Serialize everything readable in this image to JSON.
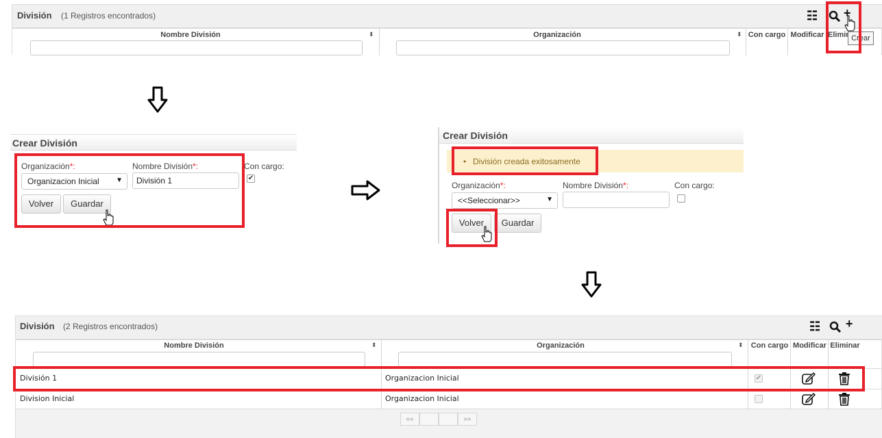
{
  "top_grid": {
    "title": "División",
    "count": "(1 Registros encontrados)",
    "headers": [
      "Nombre División",
      "Organización",
      "Con cargo",
      "Modificar",
      "Elimin"
    ],
    "tooltip": "Crear"
  },
  "form1": {
    "title": "Crear División",
    "org_label": "Organización",
    "name_label": "Nombre División",
    "charge_label": "Con cargo:",
    "required_mark": "*:",
    "org_value": "Organizacion Inicial",
    "name_value": "División 1",
    "charge_checked": true,
    "back_label": "Volver",
    "save_label": "Guardar"
  },
  "form2": {
    "title": "Crear División",
    "message": "División creada exitosamente",
    "org_label": "Organización",
    "name_label": "Nombre División",
    "charge_label": "Con cargo:",
    "required_mark": "*:",
    "org_value": "<<Seleccionar>>",
    "name_value": "",
    "charge_checked": false,
    "back_label": "Volver",
    "save_label": "Guardar"
  },
  "bottom_grid": {
    "title": "División",
    "count": "(2 Registros encontrados)",
    "headers": [
      "Nombre División",
      "Organización",
      "Con cargo",
      "Modificar",
      "Eliminar"
    ],
    "rows": [
      {
        "name": "División 1",
        "org": "Organizacion Inicial",
        "charge": true
      },
      {
        "name": "Division Inicial",
        "org": "Organizacion Inicial",
        "charge": false
      }
    ],
    "pager": {
      "first": "««",
      "next": "»»"
    }
  },
  "colors": {
    "highlight": "#e8202a",
    "message_bg": "#fcf0cd",
    "message_text": "#8a6d1e"
  }
}
